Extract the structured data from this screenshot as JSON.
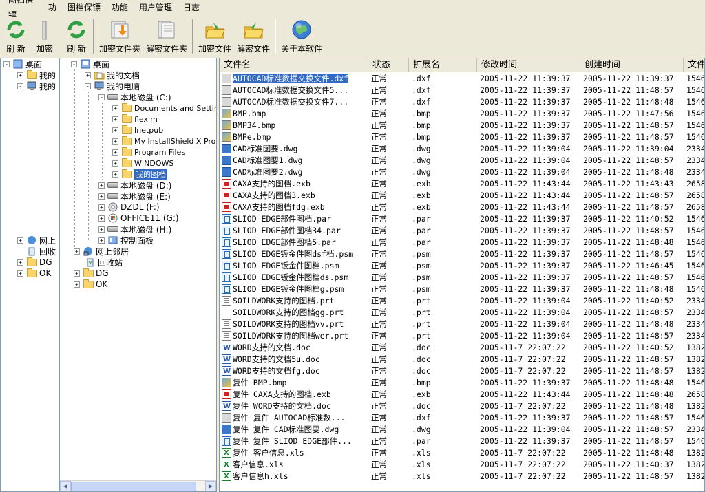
{
  "app": {
    "title": "图档保镖"
  },
  "menu": {
    "items": [
      "图档保镖",
      "功能",
      "用户管理",
      "日志"
    ],
    "bg_items": [
      "图档保镖",
      "功"
    ]
  },
  "toolbar": {
    "refresh": "刷 新",
    "encrypt_folder": "加密文件夹",
    "decrypt_folder": "解密文件夹",
    "encrypt_file": "加密文件",
    "decrypt_file": "解密文件",
    "about": "关于本软件",
    "bg_refresh": "刷 新",
    "bg_encrypt": "加密"
  },
  "bg_tree": {
    "items": [
      "桌面",
      "我的",
      "我的",
      "网上",
      "回收",
      "DG",
      "OK"
    ]
  },
  "tree": {
    "desktop": "桌面",
    "my_docs": "我的文档",
    "my_computer": "我的电脑",
    "drive_c": "本地磁盘 (C:)",
    "c_children": [
      "Documents and Settings",
      "flexlm",
      "Inetpub",
      "My InstallShield X Projects",
      "Program Files",
      "WINDOWS",
      "我的图档"
    ],
    "drive_d": "本地磁盘 (D:)",
    "drive_e": "本地磁盘 (E:)",
    "drive_f": "DZDL (F:)",
    "drive_g": "OFFICE11 (G:)",
    "drive_h": "本地磁盘 (H:)",
    "control_panel": "控制面板",
    "network": "网上邻居",
    "recycle": "回收站",
    "dg": "DG",
    "ok": "OK",
    "selected": "我的图档"
  },
  "list": {
    "columns": [
      "文件名",
      "状态",
      "扩展名",
      "修改时间",
      "创建时间",
      "文件"
    ],
    "rows": [
      {
        "name": "AUTOCAD标准数据交换文件.dxf",
        "status": "正常",
        "ext": ".dxf",
        "modified": "2005-11-22 11:39:37",
        "created": "2005-11-22 11:39:37",
        "size": "1546",
        "icon": "dxf",
        "selected": true
      },
      {
        "name": "AUTOCAD标准数据交换文件5...",
        "status": "正常",
        "ext": ".dxf",
        "modified": "2005-11-22 11:39:37",
        "created": "2005-11-22 11:48:57",
        "size": "1546",
        "icon": "dxf"
      },
      {
        "name": "AUTOCAD标准数据交换文件7...",
        "status": "正常",
        "ext": ".dxf",
        "modified": "2005-11-22 11:39:37",
        "created": "2005-11-22 11:48:48",
        "size": "1546",
        "icon": "dxf"
      },
      {
        "name": "BMP.bmp",
        "status": "正常",
        "ext": ".bmp",
        "modified": "2005-11-22 11:39:37",
        "created": "2005-11-22 11:47:56",
        "size": "1546",
        "icon": "bmp"
      },
      {
        "name": "BMP34.bmp",
        "status": "正常",
        "ext": ".bmp",
        "modified": "2005-11-22 11:39:37",
        "created": "2005-11-22 11:48:57",
        "size": "1546",
        "icon": "bmp"
      },
      {
        "name": "BMPe.bmp",
        "status": "正常",
        "ext": ".bmp",
        "modified": "2005-11-22 11:39:37",
        "created": "2005-11-22 11:48:57",
        "size": "1546",
        "icon": "bmp"
      },
      {
        "name": "CAD标准图要.dwg",
        "status": "正常",
        "ext": ".dwg",
        "modified": "2005-11-22 11:39:04",
        "created": "2005-11-22 11:39:04",
        "size": "2334",
        "icon": "dwg"
      },
      {
        "name": "CAD标准图要1.dwg",
        "status": "正常",
        "ext": ".dwg",
        "modified": "2005-11-22 11:39:04",
        "created": "2005-11-22 11:48:57",
        "size": "2334",
        "icon": "dwg"
      },
      {
        "name": "CAD标准图要2.dwg",
        "status": "正常",
        "ext": ".dwg",
        "modified": "2005-11-22 11:39:04",
        "created": "2005-11-22 11:48:48",
        "size": "2334",
        "icon": "dwg"
      },
      {
        "name": "CAXA支持的图档.exb",
        "status": "正常",
        "ext": ".exb",
        "modified": "2005-11-22 11:43:44",
        "created": "2005-11-22 11:43:43",
        "size": "2658",
        "icon": "exb"
      },
      {
        "name": "CAXA支持的图档3.exb",
        "status": "正常",
        "ext": ".exb",
        "modified": "2005-11-22 11:43:44",
        "created": "2005-11-22 11:48:57",
        "size": "2658",
        "icon": "exb"
      },
      {
        "name": "CAXA支持的图档fdg.exb",
        "status": "正常",
        "ext": ".exb",
        "modified": "2005-11-22 11:43:44",
        "created": "2005-11-22 11:48:57",
        "size": "2658",
        "icon": "exb"
      },
      {
        "name": "SLIOD EDGE部件图档.par",
        "status": "正常",
        "ext": ".par",
        "modified": "2005-11-22 11:39:37",
        "created": "2005-11-22 11:40:52",
        "size": "1546",
        "icon": "par"
      },
      {
        "name": "SLIOD EDGE部件图档34.par",
        "status": "正常",
        "ext": ".par",
        "modified": "2005-11-22 11:39:37",
        "created": "2005-11-22 11:48:57",
        "size": "1546",
        "icon": "par"
      },
      {
        "name": "SLIOD EDGE部件图档5.par",
        "status": "正常",
        "ext": ".par",
        "modified": "2005-11-22 11:39:37",
        "created": "2005-11-22 11:48:48",
        "size": "1546",
        "icon": "par"
      },
      {
        "name": "SLIOD EDGE钣金件图dsf档.psm",
        "status": "正常",
        "ext": ".psm",
        "modified": "2005-11-22 11:39:37",
        "created": "2005-11-22 11:48:57",
        "size": "1546",
        "icon": "psm"
      },
      {
        "name": "SLIOD EDGE钣金件图档.psm",
        "status": "正常",
        "ext": ".psm",
        "modified": "2005-11-22 11:39:37",
        "created": "2005-11-22 11:46:45",
        "size": "1546",
        "icon": "psm"
      },
      {
        "name": "SLIOD EDGE钣金件图档ds.psm",
        "status": "正常",
        "ext": ".psm",
        "modified": "2005-11-22 11:39:37",
        "created": "2005-11-22 11:48:57",
        "size": "1546",
        "icon": "psm"
      },
      {
        "name": "SLIOD EDGE钣金件图档g.psm",
        "status": "正常",
        "ext": ".psm",
        "modified": "2005-11-22 11:39:37",
        "created": "2005-11-22 11:48:48",
        "size": "1546",
        "icon": "psm"
      },
      {
        "name": "SOILDWORK支持的图档.prt",
        "status": "正常",
        "ext": ".prt",
        "modified": "2005-11-22 11:39:04",
        "created": "2005-11-22 11:40:52",
        "size": "2334",
        "icon": "prt"
      },
      {
        "name": "SOILDWORK支持的图档gg.prt",
        "status": "正常",
        "ext": ".prt",
        "modified": "2005-11-22 11:39:04",
        "created": "2005-11-22 11:48:57",
        "size": "2334",
        "icon": "prt"
      },
      {
        "name": "SOILDWORK支持的图档vv.prt",
        "status": "正常",
        "ext": ".prt",
        "modified": "2005-11-22 11:39:04",
        "created": "2005-11-22 11:48:48",
        "size": "2334",
        "icon": "prt"
      },
      {
        "name": "SOILDWORK支持的图档wer.prt",
        "status": "正常",
        "ext": ".prt",
        "modified": "2005-11-22 11:39:04",
        "created": "2005-11-22 11:48:57",
        "size": "2334",
        "icon": "prt"
      },
      {
        "name": "WORD支持的文档.doc",
        "status": "正常",
        "ext": ".doc",
        "modified": "2005-11-7 22:07:22",
        "created": "2005-11-22 11:40:52",
        "size": "1382",
        "icon": "doc"
      },
      {
        "name": "WORD支持的文档5u.doc",
        "status": "正常",
        "ext": ".doc",
        "modified": "2005-11-7 22:07:22",
        "created": "2005-11-22 11:48:57",
        "size": "1382",
        "icon": "doc"
      },
      {
        "name": "WORD支持的文档fg.doc",
        "status": "正常",
        "ext": ".doc",
        "modified": "2005-11-7 22:07:22",
        "created": "2005-11-22 11:48:57",
        "size": "1382",
        "icon": "doc"
      },
      {
        "name": "复件 BMP.bmp",
        "status": "正常",
        "ext": ".bmp",
        "modified": "2005-11-22 11:39:37",
        "created": "2005-11-22 11:48:48",
        "size": "1546",
        "icon": "bmp"
      },
      {
        "name": "复件 CAXA支持的图档.exb",
        "status": "正常",
        "ext": ".exb",
        "modified": "2005-11-22 11:43:44",
        "created": "2005-11-22 11:48:48",
        "size": "2658",
        "icon": "exb"
      },
      {
        "name": "复件 WORD支持的文档.doc",
        "status": "正常",
        "ext": ".doc",
        "modified": "2005-11-7 22:07:22",
        "created": "2005-11-22 11:48:48",
        "size": "1382",
        "icon": "doc"
      },
      {
        "name": "复件 复件 AUTOCAD标准数...",
        "status": "正常",
        "ext": ".dxf",
        "modified": "2005-11-22 11:39:37",
        "created": "2005-11-22 11:48:57",
        "size": "1546",
        "icon": "dxf"
      },
      {
        "name": "复件 复件 CAD标准图要.dwg",
        "status": "正常",
        "ext": ".dwg",
        "modified": "2005-11-22 11:39:04",
        "created": "2005-11-22 11:48:57",
        "size": "2334",
        "icon": "dwg"
      },
      {
        "name": "复件 复件 SLIOD EDGE部件...",
        "status": "正常",
        "ext": ".par",
        "modified": "2005-11-22 11:39:37",
        "created": "2005-11-22 11:48:57",
        "size": "1546",
        "icon": "par"
      },
      {
        "name": "复件 客户信息.xls",
        "status": "正常",
        "ext": ".xls",
        "modified": "2005-11-7 22:07:22",
        "created": "2005-11-22 11:48:48",
        "size": "1382",
        "icon": "xls"
      },
      {
        "name": "客户信息.xls",
        "status": "正常",
        "ext": ".xls",
        "modified": "2005-11-7 22:07:22",
        "created": "2005-11-22 11:40:37",
        "size": "1382",
        "icon": "xls"
      },
      {
        "name": "客户信息h.xls",
        "status": "正常",
        "ext": ".xls",
        "modified": "2005-11-7 22:07:22",
        "created": "2005-11-22 11:48:57",
        "size": "1382",
        "icon": "xls"
      }
    ]
  },
  "colors": {
    "selection": "#316ac5",
    "window_bg": "#ece9d8",
    "border": "#7f9db9"
  }
}
